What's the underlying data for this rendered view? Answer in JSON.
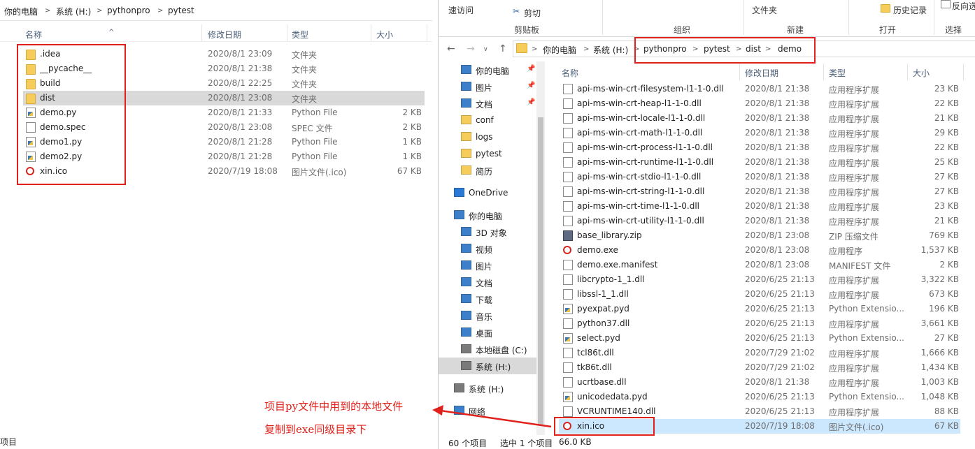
{
  "left": {
    "breadcrumb": [
      "你的电脑",
      "系统 (H:)",
      "pythonpro",
      "pytest"
    ],
    "columns": {
      "name": "名称",
      "date": "修改日期",
      "type": "类型",
      "size": "大小"
    },
    "files": [
      {
        "name": ".idea",
        "date": "2020/8/1 23:09",
        "type": "文件夹",
        "size": "",
        "icon": "folder-icon"
      },
      {
        "name": "__pycache__",
        "date": "2020/8/1 21:38",
        "type": "文件夹",
        "size": "",
        "icon": "folder-icon"
      },
      {
        "name": "build",
        "date": "2020/8/1 22:25",
        "type": "文件夹",
        "size": "",
        "icon": "folder-icon"
      },
      {
        "name": "dist",
        "date": "2020/8/1 23:08",
        "type": "文件夹",
        "size": "",
        "icon": "folder-icon"
      },
      {
        "name": "demo.py",
        "date": "2020/8/1 21:33",
        "type": "Python File",
        "size": "2 KB",
        "icon": "python-file-icon"
      },
      {
        "name": "demo.spec",
        "date": "2020/8/1 23:08",
        "type": "SPEC 文件",
        "size": "2 KB",
        "icon": "file-icon"
      },
      {
        "name": "demo1.py",
        "date": "2020/8/1 21:28",
        "type": "Python File",
        "size": "1 KB",
        "icon": "python-file-icon"
      },
      {
        "name": "demo2.py",
        "date": "2020/8/1 21:28",
        "type": "Python File",
        "size": "1 KB",
        "icon": "python-file-icon"
      },
      {
        "name": "xin.ico",
        "date": "2020/7/19 18:08",
        "type": "图片文件(.ico)",
        "size": "67 KB",
        "icon": "ico-file-icon"
      }
    ],
    "status_text": "项目"
  },
  "right": {
    "ribbon": {
      "recent_access": "速访问",
      "cut": "剪切",
      "clipboard_group": "剪贴板",
      "organize_group": "组织",
      "new_folder": "文件夹",
      "new_group": "新建",
      "history": "历史记录",
      "open_group": "打开",
      "reverse_select": "反向选择",
      "select_group": "选择"
    },
    "breadcrumb": [
      "你的电脑",
      "系统 (H:)",
      "pythonpro",
      "pytest",
      "dist",
      "demo"
    ],
    "nav": [
      {
        "label": "你的电脑",
        "icon": "computer-icon",
        "pinned": true
      },
      {
        "label": "图片",
        "icon": "pictures-icon",
        "pinned": true
      },
      {
        "label": "文档",
        "icon": "documents-icon",
        "pinned": true
      },
      {
        "label": "conf",
        "icon": "folder-icon",
        "pinned": false
      },
      {
        "label": "logs",
        "icon": "folder-icon",
        "pinned": false
      },
      {
        "label": "pytest",
        "icon": "folder-icon",
        "pinned": false
      },
      {
        "label": "简历",
        "icon": "folder-icon",
        "pinned": false
      },
      {
        "label": "OneDrive",
        "icon": "onedrive-icon",
        "pinned": false
      },
      {
        "label": "你的电脑",
        "icon": "computer-icon",
        "pinned": false
      },
      {
        "label": "3D 对象",
        "icon": "3d-objects-icon",
        "pinned": false
      },
      {
        "label": "视频",
        "icon": "videos-icon",
        "pinned": false
      },
      {
        "label": "图片",
        "icon": "pictures-icon",
        "pinned": false
      },
      {
        "label": "文档",
        "icon": "documents-icon",
        "pinned": false
      },
      {
        "label": "下载",
        "icon": "downloads-icon",
        "pinned": false
      },
      {
        "label": "音乐",
        "icon": "music-icon",
        "pinned": false
      },
      {
        "label": "桌面",
        "icon": "desktop-icon",
        "pinned": false
      },
      {
        "label": "本地磁盘 (C:)",
        "icon": "drive-icon",
        "pinned": false
      },
      {
        "label": "系统 (H:)",
        "icon": "drive-icon",
        "pinned": false
      },
      {
        "label": "系统 (H:)",
        "icon": "drive-icon",
        "pinned": false
      },
      {
        "label": "网络",
        "icon": "network-icon",
        "pinned": false
      }
    ],
    "columns": {
      "name": "名称",
      "date": "修改日期",
      "type": "类型",
      "size": "大小"
    },
    "files": [
      {
        "name": "api-ms-win-crt-filesystem-l1-1-0.dll",
        "date": "2020/8/1 21:38",
        "type": "应用程序扩展",
        "size": "23 KB",
        "icon": "dll-icon"
      },
      {
        "name": "api-ms-win-crt-heap-l1-1-0.dll",
        "date": "2020/8/1 21:38",
        "type": "应用程序扩展",
        "size": "22 KB",
        "icon": "dll-icon"
      },
      {
        "name": "api-ms-win-crt-locale-l1-1-0.dll",
        "date": "2020/8/1 21:38",
        "type": "应用程序扩展",
        "size": "21 KB",
        "icon": "dll-icon"
      },
      {
        "name": "api-ms-win-crt-math-l1-1-0.dll",
        "date": "2020/8/1 21:38",
        "type": "应用程序扩展",
        "size": "29 KB",
        "icon": "dll-icon"
      },
      {
        "name": "api-ms-win-crt-process-l1-1-0.dll",
        "date": "2020/8/1 21:38",
        "type": "应用程序扩展",
        "size": "22 KB",
        "icon": "dll-icon"
      },
      {
        "name": "api-ms-win-crt-runtime-l1-1-0.dll",
        "date": "2020/8/1 21:38",
        "type": "应用程序扩展",
        "size": "25 KB",
        "icon": "dll-icon"
      },
      {
        "name": "api-ms-win-crt-stdio-l1-1-0.dll",
        "date": "2020/8/1 21:38",
        "type": "应用程序扩展",
        "size": "27 KB",
        "icon": "dll-icon"
      },
      {
        "name": "api-ms-win-crt-string-l1-1-0.dll",
        "date": "2020/8/1 21:38",
        "type": "应用程序扩展",
        "size": "27 KB",
        "icon": "dll-icon"
      },
      {
        "name": "api-ms-win-crt-time-l1-1-0.dll",
        "date": "2020/8/1 21:38",
        "type": "应用程序扩展",
        "size": "23 KB",
        "icon": "dll-icon"
      },
      {
        "name": "api-ms-win-crt-utility-l1-1-0.dll",
        "date": "2020/8/1 21:38",
        "type": "应用程序扩展",
        "size": "21 KB",
        "icon": "dll-icon"
      },
      {
        "name": "base_library.zip",
        "date": "2020/8/1 23:08",
        "type": "ZIP 压缩文件",
        "size": "769 KB",
        "icon": "zip-icon"
      },
      {
        "name": "demo.exe",
        "date": "2020/8/1 23:08",
        "type": "应用程序",
        "size": "1,537 KB",
        "icon": "exe-icon"
      },
      {
        "name": "demo.exe.manifest",
        "date": "2020/8/1 23:08",
        "type": "MANIFEST 文件",
        "size": "2 KB",
        "icon": "file-icon"
      },
      {
        "name": "libcrypto-1_1.dll",
        "date": "2020/6/25 21:13",
        "type": "应用程序扩展",
        "size": "3,322 KB",
        "icon": "dll-icon"
      },
      {
        "name": "libssl-1_1.dll",
        "date": "2020/6/25 21:13",
        "type": "应用程序扩展",
        "size": "673 KB",
        "icon": "dll-icon"
      },
      {
        "name": "pyexpat.pyd",
        "date": "2020/6/25 21:13",
        "type": "Python Extensio...",
        "size": "196 KB",
        "icon": "python-file-icon"
      },
      {
        "name": "python37.dll",
        "date": "2020/6/25 21:13",
        "type": "应用程序扩展",
        "size": "3,661 KB",
        "icon": "dll-icon"
      },
      {
        "name": "select.pyd",
        "date": "2020/6/25 21:13",
        "type": "Python Extensio...",
        "size": "27 KB",
        "icon": "python-file-icon"
      },
      {
        "name": "tcl86t.dll",
        "date": "2020/7/29 21:02",
        "type": "应用程序扩展",
        "size": "1,666 KB",
        "icon": "dll-icon"
      },
      {
        "name": "tk86t.dll",
        "date": "2020/7/29 21:02",
        "type": "应用程序扩展",
        "size": "1,434 KB",
        "icon": "dll-icon"
      },
      {
        "name": "ucrtbase.dll",
        "date": "2020/8/1 21:38",
        "type": "应用程序扩展",
        "size": "1,003 KB",
        "icon": "dll-icon"
      },
      {
        "name": "unicodedata.pyd",
        "date": "2020/6/25 21:13",
        "type": "Python Extensio...",
        "size": "1,048 KB",
        "icon": "python-file-icon"
      },
      {
        "name": "VCRUNTIME140.dll",
        "date": "2020/6/25 21:13",
        "type": "应用程序扩展",
        "size": "88 KB",
        "icon": "dll-icon"
      },
      {
        "name": "xin.ico",
        "date": "2020/7/19 18:08",
        "type": "图片文件(.ico)",
        "size": "67 KB",
        "icon": "ico-file-icon"
      }
    ],
    "status": {
      "count": "60 个项目",
      "selected": "选中 1 个项目",
      "size": "66.0 KB"
    }
  },
  "annotation": {
    "line1": "项目py文件中用到的本地文件",
    "line2": "复制到exe同级目录下",
    "color": "#e0201a"
  }
}
